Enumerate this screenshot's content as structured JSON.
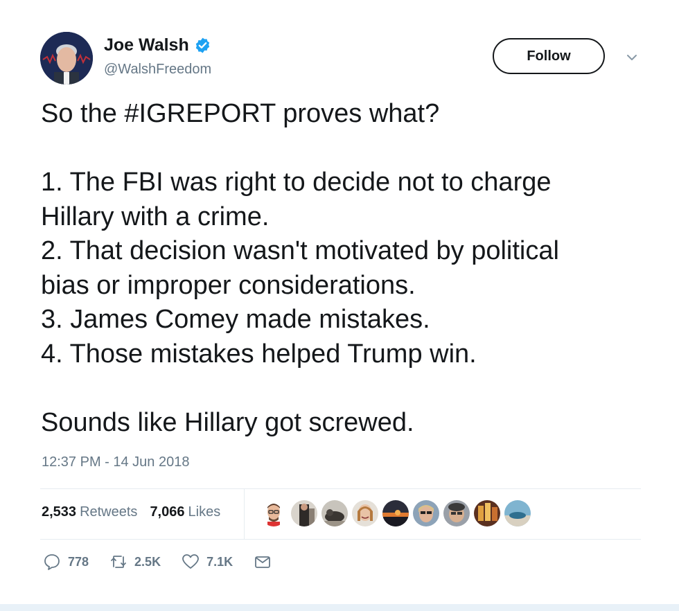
{
  "author": {
    "name": "Joe Walsh",
    "handle": "@WalshFreedom",
    "verified": true
  },
  "follow_label": "Follow",
  "body": "So the #IGREPORT proves what?\n\n1. The FBI was right to decide not to charge\nHillary with a crime.\n2. That decision wasn't motivated by political\nbias or improper considerations.\n3. James Comey made mistakes.\n4. Those mistakes helped Trump win.\n\nSounds like Hillary got screwed.",
  "timestamp": "12:37 PM - 14 Jun 2018",
  "stats": {
    "retweets_count": "2,533",
    "retweets_label": "Retweets",
    "likes_count": "7,066",
    "likes_label": "Likes"
  },
  "actions": {
    "replies": "778",
    "retweets": "2.5K",
    "likes": "7.1K"
  },
  "colors": {
    "text": "#14171a",
    "secondary": "#657786",
    "verified": "#1da1f2",
    "divider": "#e6ecf0"
  }
}
